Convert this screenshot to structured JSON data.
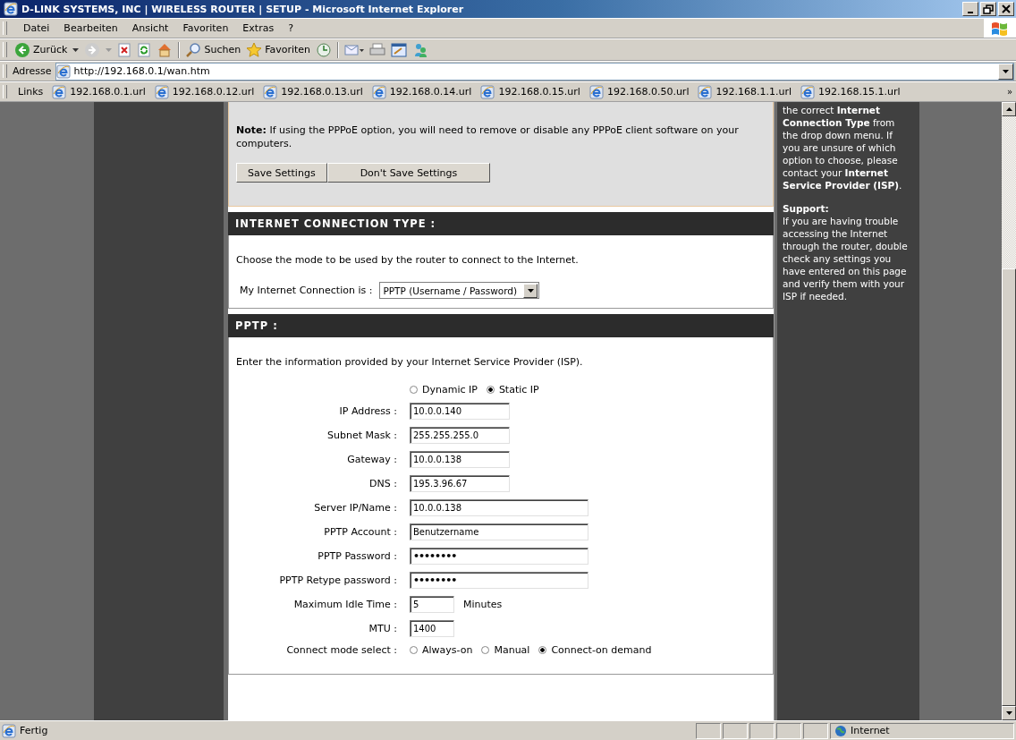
{
  "window": {
    "title": "D-LINK SYSTEMS, INC | WIRELESS ROUTER | SETUP - Microsoft Internet Explorer"
  },
  "menu_bar": {
    "items": [
      "Datei",
      "Bearbeiten",
      "Ansicht",
      "Favoriten",
      "Extras",
      "?"
    ]
  },
  "toolbar": {
    "back": "Zurück",
    "search": "Suchen",
    "favorites": "Favoriten"
  },
  "address_bar": {
    "label": "Adresse",
    "url": "http://192.168.0.1/wan.htm"
  },
  "links_bar": {
    "label": "Links",
    "items": [
      "192.168.0.1.url",
      "192.168.0.12.url",
      "192.168.0.13.url",
      "192.168.0.14.url",
      "192.168.0.15.url",
      "192.168.0.50.url",
      "192.168.1.1.url",
      "192.168.15.1.url"
    ],
    "more": "»"
  },
  "note_section": {
    "note": "**Note:** If using the PPPoE option, you will need to remove or disable any PPPoE client software on your computers.",
    "buttons": [
      "Save Settings",
      "Don't Save Settings"
    ]
  },
  "connection_type": {
    "title": "INTERNET CONNECTION TYPE :",
    "description": "Choose the mode to be used by the router to connect to the Internet.",
    "label": "My Internet Connection is :",
    "value": "PPTP (Username / Password)"
  },
  "pptp": {
    "title": "PPTP :",
    "description": "Enter the information provided by your Internet Service Provider (ISP).",
    "ip_mode": [
      {
        "label": "Dynamic IP",
        "selected": false
      },
      {
        "label": "Static IP",
        "selected": true
      }
    ],
    "fields": [
      {
        "label": "IP Address :",
        "value": "10.0.0.140",
        "kind": "short"
      },
      {
        "label": "Subnet Mask :",
        "value": "255.255.255.0",
        "kind": "short"
      },
      {
        "label": "Gateway :",
        "value": "10.0.0.138",
        "kind": "short"
      },
      {
        "label": "DNS :",
        "value": "195.3.96.67",
        "kind": "short"
      },
      {
        "label": "Server IP/Name :",
        "value": "10.0.0.138",
        "kind": "long"
      },
      {
        "label": "PPTP Account :",
        "value": "Benutzername",
        "kind": "long"
      },
      {
        "label": "PPTP Password :",
        "value": "••••••••",
        "kind": "password"
      },
      {
        "label": "PPTP Retype password :",
        "value": "••••••••",
        "kind": "password"
      },
      {
        "label": "Maximum Idle Time :",
        "value": "5",
        "kind": "tiny",
        "suffix": "Minutes"
      },
      {
        "label": "MTU :",
        "value": "1400",
        "kind": "tiny"
      }
    ],
    "connect_mode": {
      "label": "Connect mode select :",
      "options": [
        {
          "label": "Always-on",
          "selected": false
        },
        {
          "label": "Manual",
          "selected": false
        },
        {
          "label": "Connect-on demand",
          "selected": true
        }
      ]
    }
  },
  "help": {
    "paragraphs": [
      "the correct **Internet Connection Type** from the drop down menu. If you are unsure of which option to choose, please contact your **Internet Service Provider (ISP)**.",
      "**Support:**\nIf you are having trouble accessing the Internet through the router, double check any settings you have entered on this page and verify them with your ISP if needed."
    ]
  },
  "status_bar": {
    "text": "Fertig",
    "zone": "Internet"
  }
}
